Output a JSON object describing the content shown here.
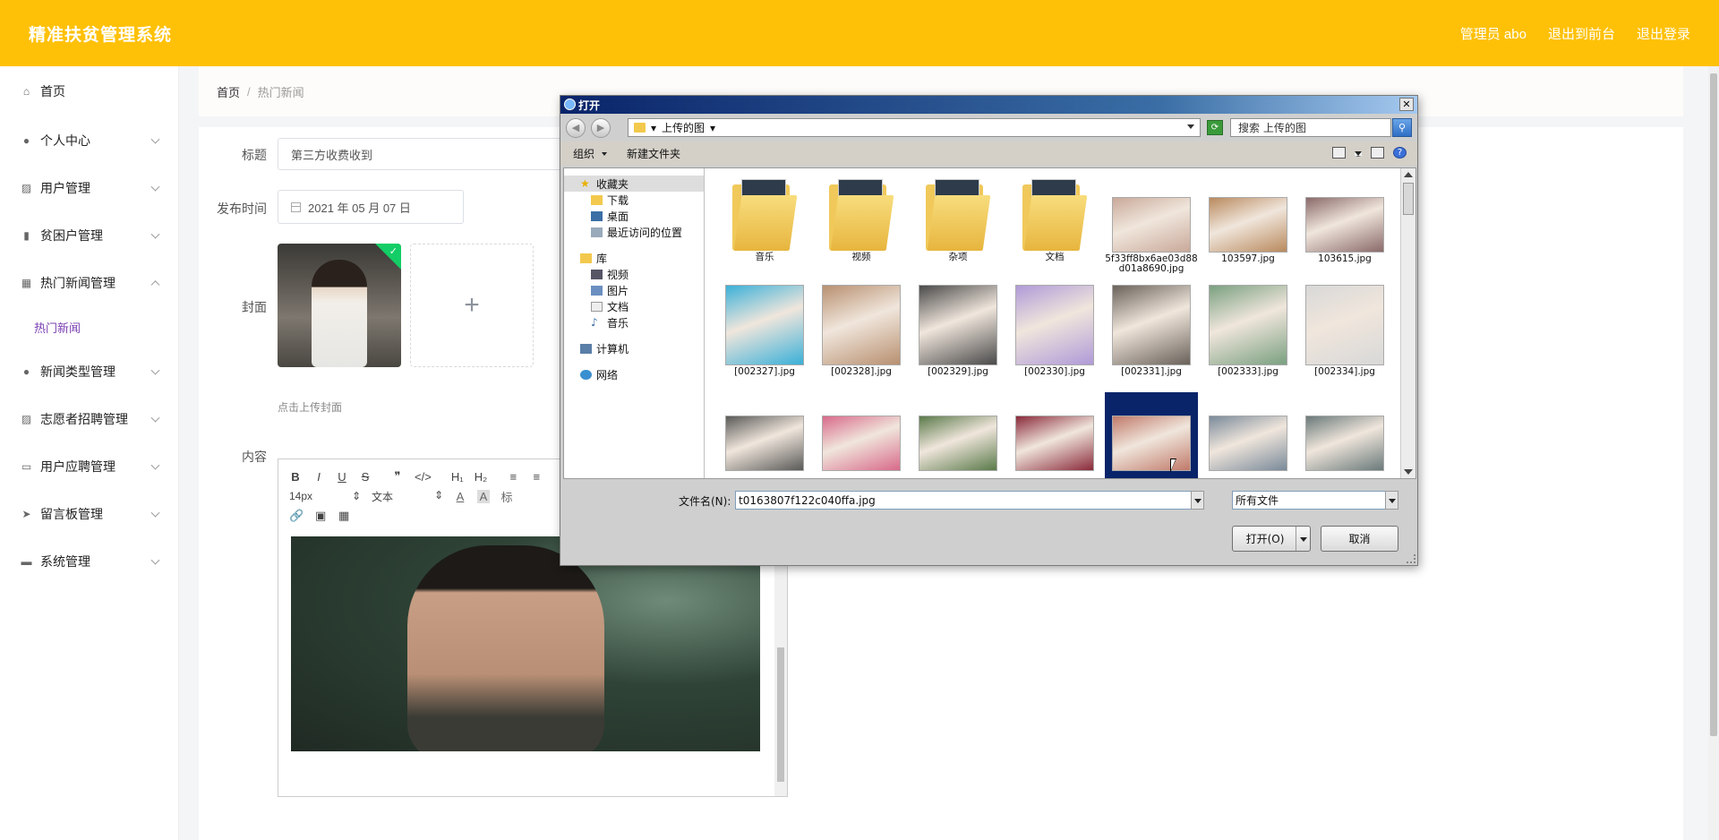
{
  "header": {
    "brand": "精准扶贫管理系统",
    "admin_label": "管理员 abo",
    "exit_front": "退出到前台",
    "logout": "退出登录"
  },
  "sidebar": {
    "items": [
      {
        "label": "首页",
        "icon": "home-icon"
      },
      {
        "label": "个人中心",
        "icon": "user-icon"
      },
      {
        "label": "用户管理",
        "icon": "chart-icon"
      },
      {
        "label": "贫困户管理",
        "icon": "bar-chart-icon"
      },
      {
        "label": "热门新闻管理",
        "icon": "grid-icon",
        "expanded": true
      },
      {
        "label": "新闻类型管理",
        "icon": "user-icon"
      },
      {
        "label": "志愿者招聘管理",
        "icon": "chart-icon"
      },
      {
        "label": "用户应聘管理",
        "icon": "message-icon"
      },
      {
        "label": "留言板管理",
        "icon": "send-icon"
      },
      {
        "label": "系统管理",
        "icon": "briefcase-icon"
      }
    ],
    "active_sub": "热门新闻"
  },
  "breadcrumb": {
    "home": "首页",
    "separator": "/",
    "current": "热门新闻"
  },
  "form": {
    "title_label": "标题",
    "title_value": "第三方收费收到",
    "date_label": "发布时间",
    "date_value": "2021 年 05 月 07 日",
    "cover_label": "封面",
    "upload_plus": "+",
    "upload_hint": "点击上传封面",
    "content_label": "内容"
  },
  "editor": {
    "row1": [
      "B",
      "I",
      "U",
      "S",
      "❞",
      "</>",
      "H₁",
      "H₂",
      "≡",
      "≡"
    ],
    "font_size": "14px",
    "font_size_arrow": "⇕",
    "text_type": "文本",
    "text_type_arrow": "⇕",
    "font_color": "A",
    "bg_color": "A",
    "more": "标",
    "row3": [
      "🔗",
      "▣",
      "▦"
    ]
  },
  "dialog": {
    "title": "打开",
    "close": "✕",
    "nav_back": "◀",
    "nav_forward": "▶",
    "address": "上传的图",
    "address_arrow": "▾",
    "refresh": "⟳",
    "search_placeholder": "搜索 上传的图",
    "search_icon": "⚲",
    "organize": "组织",
    "new_folder": "新建文件夹",
    "help": "?",
    "tree": {
      "favorites": "收藏夹",
      "favorites_items": [
        "下载",
        "桌面",
        "最近访问的位置"
      ],
      "library": "库",
      "library_items": [
        "视频",
        "图片",
        "文档",
        "音乐"
      ],
      "computer": "计算机",
      "network": "网络"
    },
    "files": [
      {
        "name": "音乐",
        "type": "folder"
      },
      {
        "name": "视频",
        "type": "folder"
      },
      {
        "name": "杂项",
        "type": "folder"
      },
      {
        "name": "文档",
        "type": "folder"
      },
      {
        "name": "5f33ff8bx6ae03d88d01a8690.jpg",
        "type": "image",
        "color": "#c9a99a"
      },
      {
        "name": "103597.jpg",
        "type": "image",
        "color": "#b98a5e"
      },
      {
        "name": "103615.jpg",
        "type": "image",
        "color": "#8a6a6a"
      },
      {
        "name": "[002327].jpg",
        "type": "image",
        "color": "#3bb0d8"
      },
      {
        "name": "[002328].jpg",
        "type": "image",
        "color": "#b89070"
      },
      {
        "name": "[002329].jpg",
        "type": "image",
        "color": "#4a4a4a"
      },
      {
        "name": "[002330].jpg",
        "type": "image",
        "color": "#b09ad8"
      },
      {
        "name": "[002331].jpg",
        "type": "image",
        "color": "#6a625a"
      },
      {
        "name": "[002333].jpg",
        "type": "image",
        "color": "#7aa080"
      },
      {
        "name": "[002334].jpg",
        "type": "image",
        "color": "#d8d8d8"
      },
      {
        "name": "",
        "type": "image",
        "color": "#5a5a58"
      },
      {
        "name": "",
        "type": "image",
        "color": "#d86a8a"
      },
      {
        "name": "",
        "type": "image",
        "color": "#5a7a4a"
      },
      {
        "name": "",
        "type": "image",
        "color": "#8a2a3a"
      },
      {
        "name": "",
        "type": "image",
        "color": "#c07a6a",
        "selected": true
      },
      {
        "name": "",
        "type": "image",
        "color": "#7a8a9a"
      },
      {
        "name": "",
        "type": "image",
        "color": "#6a7a7a"
      }
    ],
    "filename_label": "文件名(N):",
    "filename_value": "t0163807f122c040ffa.jpg",
    "filetype_value": "所有文件",
    "open_button": "打开(O)",
    "cancel_button": "取消"
  }
}
